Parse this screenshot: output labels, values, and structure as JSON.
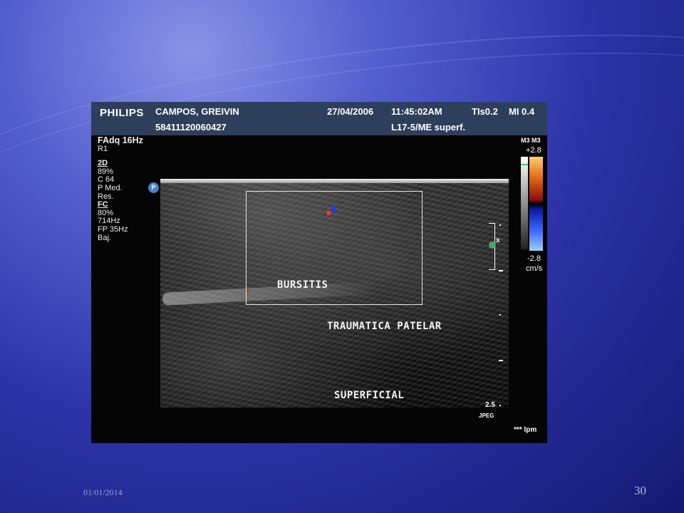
{
  "header": {
    "brand": "PHILIPS",
    "patient_name": "CAMPOS, GREIVIN",
    "date": "27/04/2006",
    "time": "11:45:02AM",
    "tis": "TIs0.2",
    "mi": "MI 0.4",
    "patient_id": "58411120060427",
    "probe_preset": "L17-5/ME superf."
  },
  "params": {
    "frame_rate": "FAdq 16Hz",
    "r": "R1",
    "mode_2d": "2D",
    "gain_2d": " 89%",
    "compression": "C 64",
    "persistence": "P Med.",
    "resolution": "Res.",
    "mode_fc": "FC",
    "gain_fc": " 80%",
    "prf": "  714Hz",
    "filter": "FP  35Hz",
    "flow": "Baj."
  },
  "probe_badge": "P",
  "colorbar": {
    "map": "M3 M3",
    "max": "+2.8",
    "min": "-2.8",
    "unit": "cm/s",
    "colors": {
      "top": "#ffd070",
      "mid_red": "#8a0f0f",
      "mid_blue": "#0b1aa0",
      "bottom": "#9cd0ff"
    }
  },
  "focus_marker": "x",
  "annotations": {
    "line1": "BURSITIS",
    "line2": "TRAUMATICA PATELAR",
    "line3": "SUPERFICIAL"
  },
  "depth": "2.5",
  "format": "JPEG",
  "lpm": "*** lpm",
  "footer": {
    "date": "01/01/2014",
    "page": "30"
  }
}
